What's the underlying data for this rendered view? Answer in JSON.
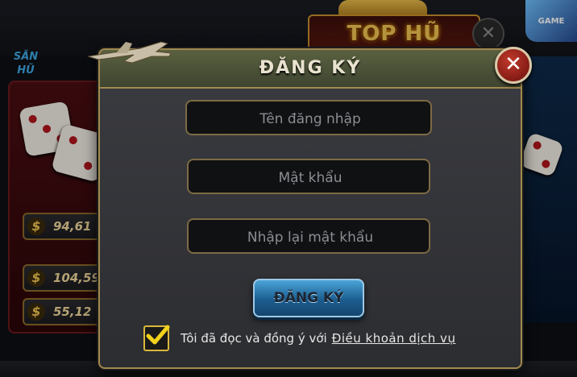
{
  "background": {
    "top_banner": "TOP HŨ",
    "top_close_glyph": "✕",
    "game_badge": "GAME",
    "sanhu_tag": [
      "SĂN",
      "HŨ"
    ],
    "jackpots": [
      "94,61",
      "104,59",
      "55,12"
    ],
    "currency_symbol": "$"
  },
  "dialog": {
    "title": "ĐĂNG KÝ",
    "close_glyph": "✕",
    "fields": {
      "username_placeholder": "Tên đăng nhập",
      "password_placeholder": "Mật khẩu",
      "confirm_placeholder": "Nhập lại mật khẩu"
    },
    "submit_label": "ĐĂNG KÝ",
    "agree_text": "Tôi đã đọc và đồng ý với",
    "terms_link": "Điều khoản dịch vụ",
    "agree_checked": true
  },
  "colors": {
    "accent_gold": "#a28a4e",
    "button_blue": "#1c5d8f",
    "checkbox_yellow": "#f2d21a"
  }
}
